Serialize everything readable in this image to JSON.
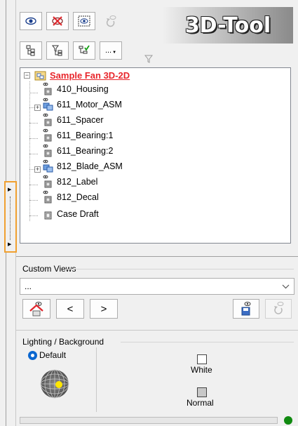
{
  "toolbar": {
    "row1": [
      {
        "name": "show-icon",
        "glyph": "◉"
      },
      {
        "name": "hide-icon",
        "glyph": "✖"
      },
      {
        "name": "select-show-icon",
        "glyph": "◉"
      },
      {
        "name": "undo-visibility-icon",
        "glyph": "↺"
      }
    ],
    "row2": [
      {
        "name": "tree-expand-icon"
      },
      {
        "name": "tree-filter-icon"
      },
      {
        "name": "tree-check-icon"
      },
      {
        "name": "more-options-icon",
        "label": "..."
      }
    ],
    "logo_text": "3D-Tool"
  },
  "tree": {
    "root_label": "Sample Fan  3D-2D",
    "items": [
      {
        "label": "410_Housing",
        "type": "part",
        "expandable": false
      },
      {
        "label": "611_Motor_ASM",
        "type": "assembly",
        "expandable": true
      },
      {
        "label": "611_Spacer",
        "type": "part",
        "expandable": false
      },
      {
        "label": "611_Bearing:1",
        "type": "part",
        "expandable": false
      },
      {
        "label": "611_Bearing:2",
        "type": "part",
        "expandable": false
      },
      {
        "label": "812_Blade_ASM",
        "type": "assembly",
        "expandable": true
      },
      {
        "label": "812_Label",
        "type": "part",
        "expandable": false
      },
      {
        "label": "812_Decal",
        "type": "part",
        "expandable": false
      },
      {
        "label": "Case Draft",
        "type": "part",
        "expandable": false
      }
    ]
  },
  "custom_views": {
    "title": "Custom Views",
    "selected": "...",
    "prev_label": "<",
    "next_label": ">"
  },
  "lighting": {
    "title": "Lighting / Background",
    "default_label": "Default",
    "white_label": "White",
    "normal_label": "Normal"
  },
  "colors": {
    "highlight_border": "#f0a030",
    "root_text": "#e8262c",
    "status_ok": "#108a10",
    "radio_selected": "#0b67d0"
  }
}
